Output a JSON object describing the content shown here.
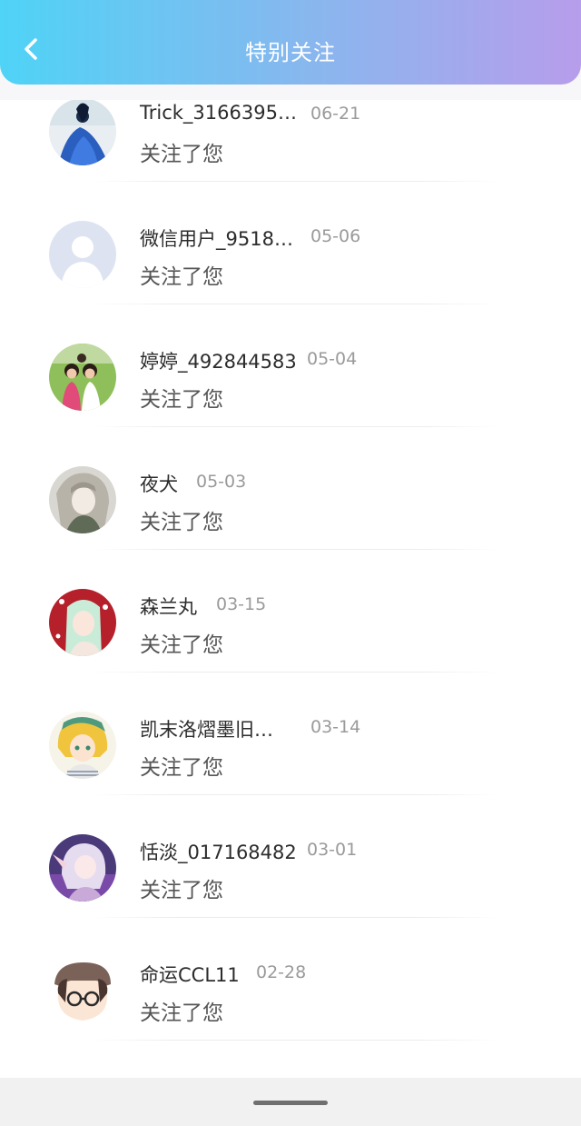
{
  "header": {
    "title": "特别关注",
    "back_icon": "chevron-left-icon",
    "gradient": [
      "#4fd3f6",
      "#8ab6ee",
      "#b79deb"
    ]
  },
  "notifications": [
    {
      "name": "Trick_3166395…",
      "date": "06-21",
      "message": "关注了您",
      "avatar": "photo-blue-dress-avatar"
    },
    {
      "name": "微信用户_9518…",
      "date": "05-06",
      "message": "关注了您",
      "avatar": "default-user-avatar"
    },
    {
      "name": "婷婷_492844583",
      "date": "05-04",
      "message": "关注了您",
      "avatar": "photo-girls-avatar"
    },
    {
      "name": "夜犬",
      "date": "05-03",
      "message": "关注了您",
      "avatar": "anime-gray-avatar"
    },
    {
      "name": "森兰丸",
      "date": "03-15",
      "message": "关注了您",
      "avatar": "anime-red-avatar"
    },
    {
      "name": "凯末洛熠墨旧…",
      "date": "03-14",
      "message": "关注了您",
      "avatar": "anime-blonde-avatar"
    },
    {
      "name": "恬淡_017168482",
      "date": "03-01",
      "message": "关注了您",
      "avatar": "anime-purple-avatar"
    },
    {
      "name": "命运CCL11",
      "date": "02-28",
      "message": "关注了您",
      "avatar": "chibi-glasses-avatar"
    }
  ]
}
